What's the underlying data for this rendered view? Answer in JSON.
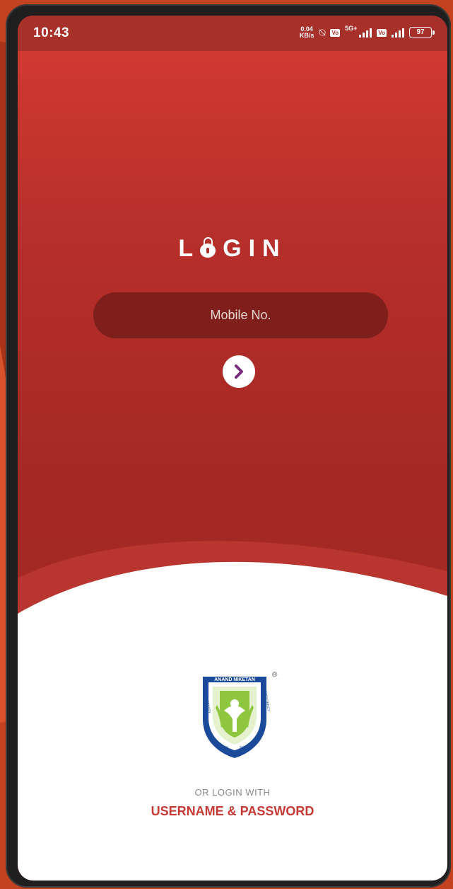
{
  "status_bar": {
    "time": "10:43",
    "net_speed_value": "0.04",
    "net_speed_unit": "KB/s",
    "volte1": "Vo",
    "network_5g": "5G+",
    "volte2": "Vo",
    "battery": "97"
  },
  "login": {
    "title_prefix": "L",
    "title_suffix": "GIN",
    "mobile_placeholder": "Mobile No."
  },
  "logo": {
    "top_text": "ANAND NIKETAN",
    "left_text": "ACTIVITY",
    "right_text": "PROFICIENCY",
    "bottom_left": "JOY",
    "bottom_right": "SKILL",
    "registered": "®"
  },
  "footer": {
    "or_login_with": "OR LOGIN WITH",
    "username_password": "USERNAME & PASSWORD"
  },
  "colors": {
    "primary_red": "#a52824",
    "accent_purple": "#7a2b7c",
    "footer_link": "#c53a35"
  }
}
